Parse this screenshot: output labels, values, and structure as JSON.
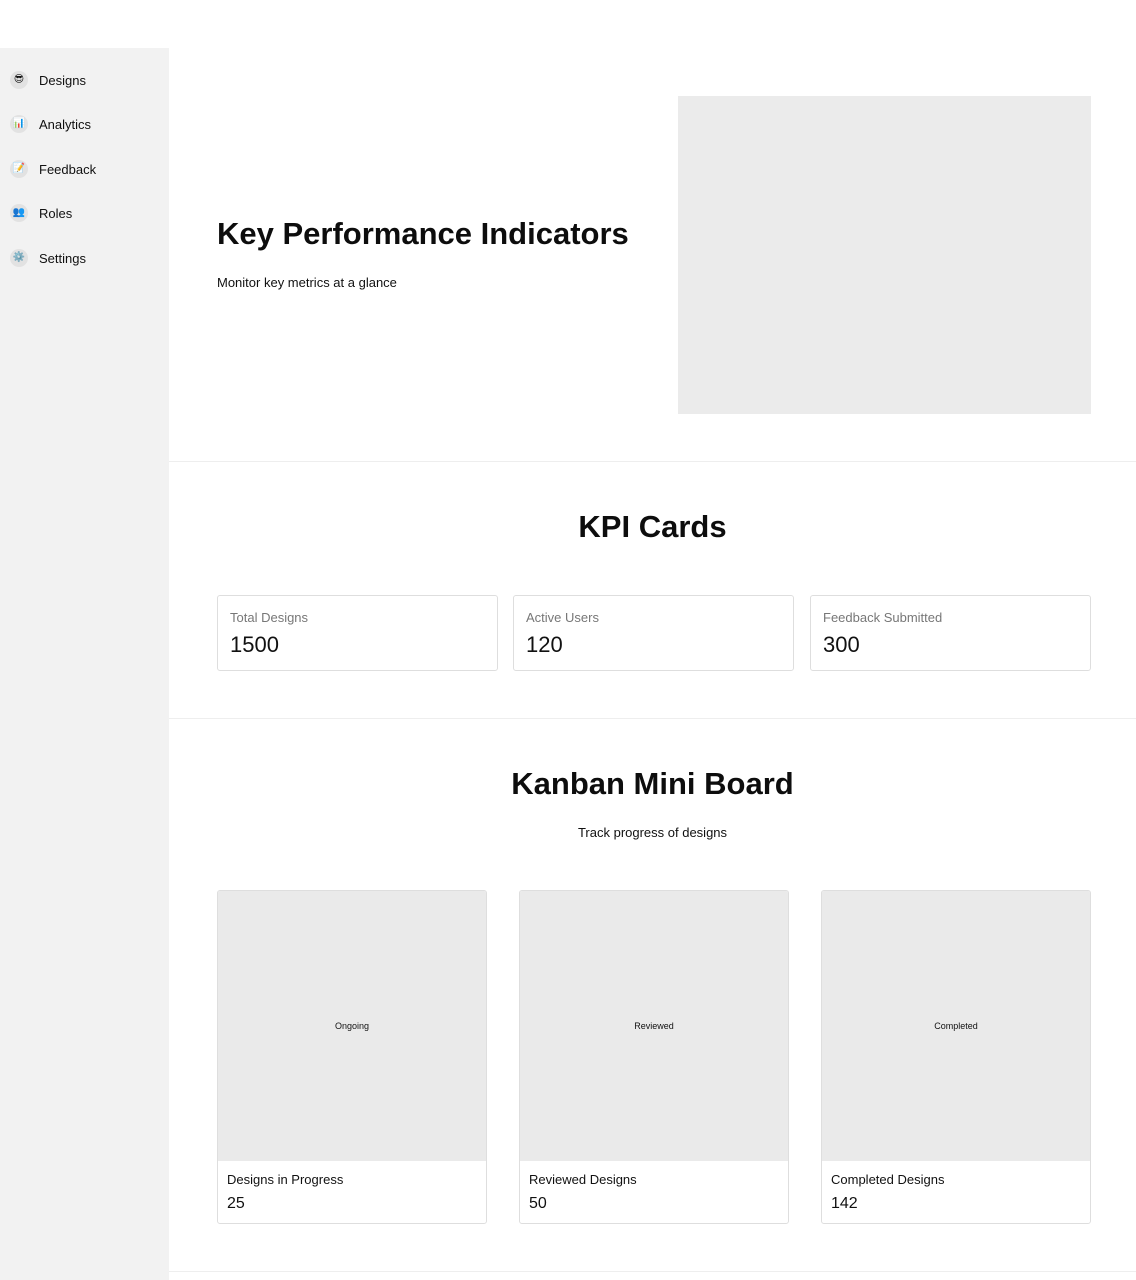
{
  "sidebar": {
    "items": [
      {
        "icon": "😎",
        "label": "Designs"
      },
      {
        "icon": "📊",
        "label": "Analytics"
      },
      {
        "icon": "📝",
        "label": "Feedback"
      },
      {
        "icon": "👥",
        "label": "Roles"
      },
      {
        "icon": "⚙️",
        "label": "Settings"
      }
    ]
  },
  "hero": {
    "title": "Key Performance Indicators",
    "subtitle": "Monitor key metrics at a glance"
  },
  "kpi": {
    "title": "KPI Cards",
    "cards": [
      {
        "label": "Total Designs",
        "value": "1500"
      },
      {
        "label": "Active Users",
        "value": "120"
      },
      {
        "label": "Feedback Submitted",
        "value": "300"
      }
    ]
  },
  "kanban": {
    "title": "Kanban Mini Board",
    "subtitle": "Track progress of designs",
    "columns": [
      {
        "image_label": "Ongoing",
        "title": "Designs in Progress",
        "count": "25"
      },
      {
        "image_label": "Reviewed",
        "title": "Reviewed Designs",
        "count": "50"
      },
      {
        "image_label": "Completed",
        "title": "Completed Designs",
        "count": "142"
      }
    ]
  },
  "colors": {
    "sidebar_bg": "#f2f2f2",
    "placeholder_bg": "#ebebeb",
    "card_border": "#dedede",
    "muted_text": "#777777"
  }
}
